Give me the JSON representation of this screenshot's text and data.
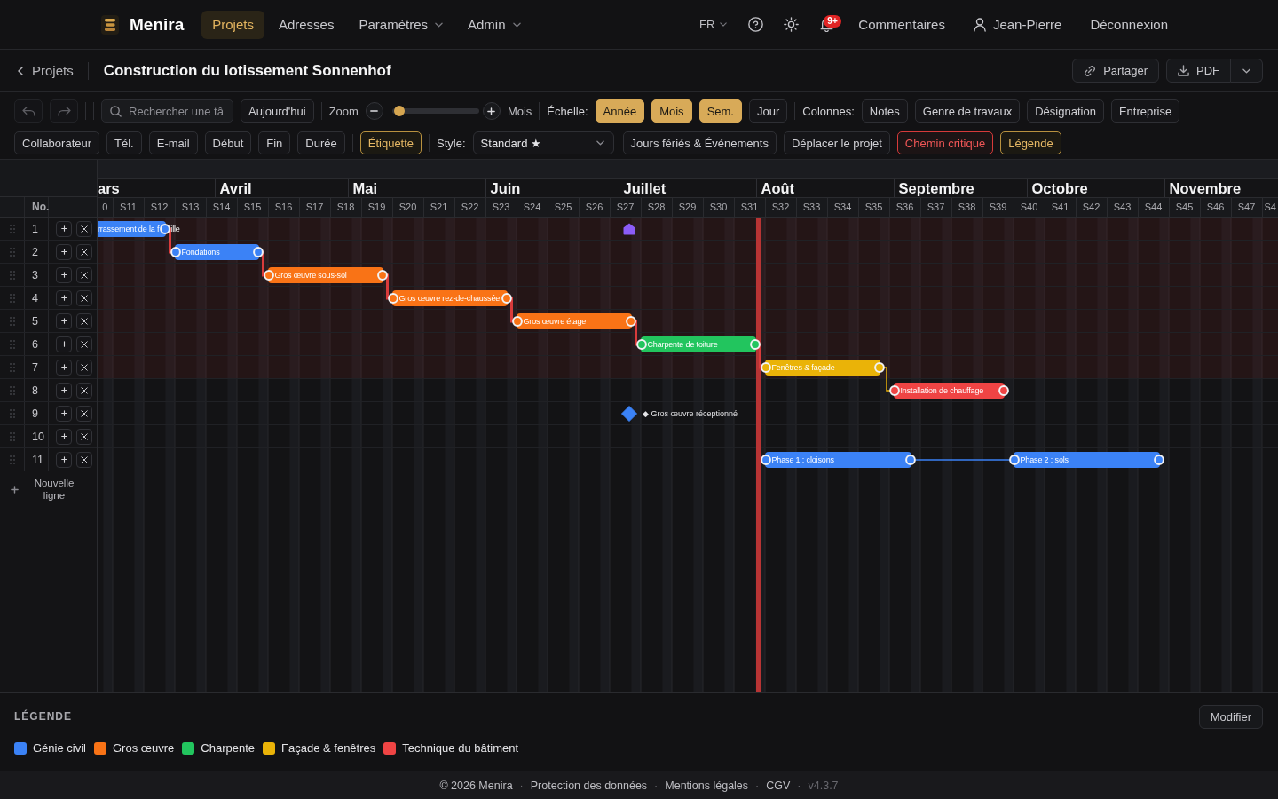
{
  "nav": {
    "brand": "Menira",
    "items": [
      {
        "label": "Projets",
        "selected": true,
        "has_menu": false
      },
      {
        "label": "Adresses",
        "selected": false,
        "has_menu": false
      },
      {
        "label": "Paramètres",
        "selected": false,
        "has_menu": true
      },
      {
        "label": "Admin",
        "selected": false,
        "has_menu": true
      }
    ],
    "language": "FR",
    "notifications": "9+",
    "comments": "Commentaires",
    "user": "Jean-Pierre",
    "logout": "Déconnexion"
  },
  "project": {
    "back": "Projets",
    "title": "Construction du lotissement Sonnenhof",
    "share": "Partager",
    "export": "PDF"
  },
  "toolbar": {
    "undo": {
      "disabled": true
    },
    "redo": {
      "disabled": true
    },
    "search": {
      "placeholder": "Rechercher une tâ"
    },
    "today": "Aujourd'hui",
    "zoom": {
      "label": "Zoom",
      "level": 0.08,
      "reading": "Mois"
    },
    "scale": {
      "label": "Échelle:",
      "options": [
        {
          "label": "Année",
          "selected": true
        },
        {
          "label": "Mois",
          "selected": true
        },
        {
          "label": "Sem.",
          "selected": true
        },
        {
          "label": "Jour",
          "selected": false
        }
      ]
    },
    "columns": {
      "label": "Colonnes:",
      "options": [
        {
          "label": "Notes",
          "on": false
        },
        {
          "label": "Genre de travaux",
          "on": false
        },
        {
          "label": "Désignation",
          "on": false
        },
        {
          "label": "Entreprise",
          "on": false
        }
      ]
    },
    "fields": [
      {
        "label": "Collaborateur",
        "on": false
      },
      {
        "label": "Tél.",
        "on": false
      },
      {
        "label": "E-mail",
        "on": false
      },
      {
        "label": "Début",
        "on": false
      },
      {
        "label": "Fin",
        "on": false
      },
      {
        "label": "Durée",
        "on": false
      }
    ],
    "label_toggle": {
      "label": "Étiquette",
      "on": true
    },
    "style": {
      "label": "Style:",
      "value": "Standard ★"
    },
    "actions": [
      {
        "label": "Jours fériés & Événements",
        "kind": "action"
      },
      {
        "label": "Déplacer le projet",
        "kind": "action"
      },
      {
        "label": "Chemin critique",
        "kind": "critical",
        "on": true
      },
      {
        "label": "Légende",
        "kind": "toggle",
        "on": true
      }
    ]
  },
  "gantt": {
    "column_header": "No.",
    "months": [
      "ars",
      "Avril",
      "Mai",
      "Juin",
      "Juillet",
      "Août",
      "Septembre",
      "Octobre",
      "Novembre"
    ],
    "weeks": [
      "0",
      "S11",
      "S12",
      "S13",
      "S14",
      "S15",
      "S16",
      "S17",
      "S18",
      "S19",
      "S20",
      "S21",
      "S22",
      "S23",
      "S24",
      "S25",
      "S26",
      "S27",
      "S28",
      "S29",
      "S30",
      "S31",
      "S32",
      "S33",
      "S34",
      "S35",
      "S36",
      "S37",
      "S38",
      "S39",
      "S40",
      "S41",
      "S42",
      "S43",
      "S44",
      "S45",
      "S46",
      "S47",
      "S4"
    ],
    "rows": [
      {
        "no": "1",
        "critical": true,
        "task": {
          "kind": "bar",
          "label": "rrassement de la f",
          "label_tail": "ille",
          "color": "#3b82f6",
          "link_next": true
        }
      },
      {
        "no": "2",
        "critical": true,
        "task": {
          "kind": "bar",
          "label": "Fondations",
          "color": "#3b82f6",
          "link_next": true
        }
      },
      {
        "no": "3",
        "critical": true,
        "task": {
          "kind": "bar",
          "label": "Gros œuvre sous-sol",
          "color": "#f97316",
          "link_next": true
        }
      },
      {
        "no": "4",
        "critical": true,
        "task": {
          "kind": "bar",
          "label": "Gros œuvre rez-de-chaussée",
          "color": "#f97316",
          "link_next": true
        }
      },
      {
        "no": "5",
        "critical": true,
        "task": {
          "kind": "bar",
          "label": "Gros œuvre étage",
          "color": "#f97316",
          "link_next": true
        }
      },
      {
        "no": "6",
        "critical": true,
        "task": {
          "kind": "bar",
          "label": "Charpente de toiture",
          "color": "#22c55e",
          "link_next": true
        }
      },
      {
        "no": "7",
        "critical": true,
        "task": {
          "kind": "bar",
          "label": "Fenêtres & façade",
          "color": "#eab308",
          "link_next": true
        }
      },
      {
        "no": "8",
        "critical": false,
        "task": {
          "kind": "bar",
          "label": "Installation de chauffage",
          "color": "#ef4444",
          "link_next": false
        }
      },
      {
        "no": "9",
        "critical": false,
        "task": {
          "kind": "milestone",
          "label": "◆ Gros œuvre réceptionné",
          "color": "#3b82f6"
        }
      },
      {
        "no": "10",
        "critical": false
      },
      {
        "no": "11",
        "critical": false,
        "task": {
          "kind": "split",
          "color": "#3b82f6",
          "segments": [
            {
              "label": "Phase 1 : cloisons"
            },
            {
              "label": "Phase 2 : sols"
            }
          ]
        }
      }
    ],
    "new_row": "Nouvelle ligne"
  },
  "legend": {
    "title": "LÉGENDE",
    "edit": "Modifier",
    "items": [
      {
        "label": "Génie civil",
        "color": "#3b82f6"
      },
      {
        "label": "Gros œuvre",
        "color": "#f97316"
      },
      {
        "label": "Charpente",
        "color": "#22c55e"
      },
      {
        "label": "Façade & fenêtres",
        "color": "#eab308"
      },
      {
        "label": "Technique du bâtiment",
        "color": "#ef4444"
      }
    ]
  },
  "footer": {
    "items": [
      {
        "kind": "text",
        "label": "© 2026 Menira"
      },
      {
        "kind": "separator",
        "label": "·"
      },
      {
        "kind": "link",
        "label": "Protection des données"
      },
      {
        "kind": "separator",
        "label": "·"
      },
      {
        "kind": "link",
        "label": "Mentions légales"
      },
      {
        "kind": "separator",
        "label": "·"
      },
      {
        "kind": "link",
        "label": "CGV"
      },
      {
        "kind": "separator",
        "label": "·"
      },
      {
        "kind": "version",
        "label": "v4.3.7"
      }
    ]
  }
}
